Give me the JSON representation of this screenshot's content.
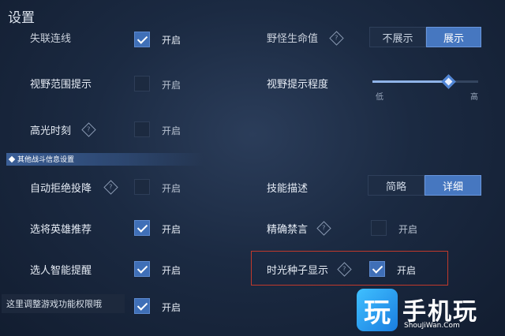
{
  "header": {
    "title": "设置"
  },
  "watermark": {
    "logo_char": "玩",
    "brand": "手机玩",
    "url": "ShouJiWan.Com"
  },
  "top_partial": {
    "left_label": "失联连线",
    "left_checked": true,
    "left_state": "开启",
    "right_label": "野怪生命值",
    "right_options": [
      "不展示",
      "展示"
    ],
    "right_selected": 1
  },
  "rows_left": [
    {
      "label": "视野范围提示",
      "checked": false,
      "state": "开启"
    },
    {
      "label": "高光时刻",
      "help": true,
      "checked": false,
      "state": "开启"
    }
  ],
  "vision_slider": {
    "label": "视野提示程度",
    "min_label": "低",
    "max_label": "高",
    "value": 0.72
  },
  "section": {
    "title": "其他战斗信息设置"
  },
  "battle_left": [
    {
      "label": "自动拒绝投降",
      "help": true,
      "checked": false,
      "state": "开启"
    },
    {
      "label": "选将英雄推荐",
      "help": false,
      "checked": true,
      "state": "开启"
    },
    {
      "label": "选人智能提醒",
      "help": false,
      "checked": true,
      "state": "开启"
    }
  ],
  "skill_desc": {
    "label": "技能描述",
    "options": [
      "简略",
      "详细"
    ],
    "selected": 1
  },
  "precise_ban": {
    "label": "精确禁言",
    "help": true,
    "checked": false,
    "state": "开启"
  },
  "time_seed": {
    "label": "时光种子显示",
    "help": true,
    "checked": true,
    "state": "开启"
  },
  "bottom": {
    "tooltip": "这里调整游戏功能权限哦",
    "checked": true,
    "state": "开启"
  },
  "colors": {
    "accent": "#4677c0",
    "highlight": "#c0392b"
  },
  "help_glyph": "?"
}
